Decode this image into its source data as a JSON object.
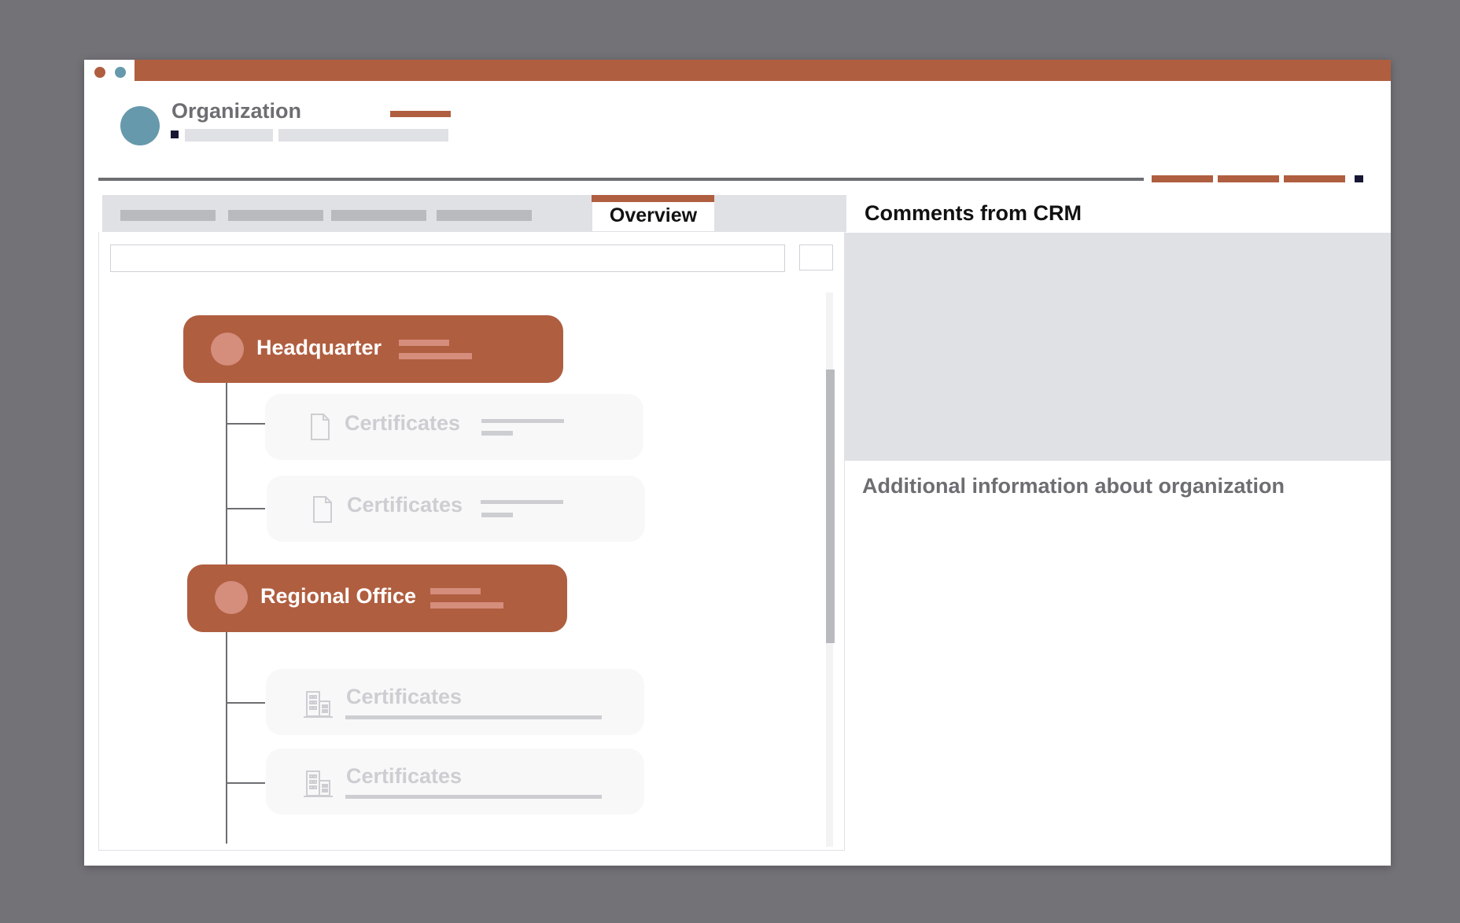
{
  "window": {
    "controls": [
      {
        "name": "close",
        "color": "#b05e40"
      },
      {
        "name": "minimize",
        "color": "#6699ab"
      }
    ]
  },
  "header": {
    "title": "Organization",
    "avatar_color": "#6699ab"
  },
  "tabs": {
    "active_label": "Overview"
  },
  "tree": {
    "nodes": [
      {
        "label": "Headquarter",
        "children": [
          {
            "label": "Certificates",
            "icon": "document-icon"
          },
          {
            "label": "Certificates",
            "icon": "document-icon"
          }
        ]
      },
      {
        "label": "Regional Office",
        "children": [
          {
            "label": "Certificates",
            "icon": "building-icon"
          },
          {
            "label": "Certificates",
            "icon": "building-icon"
          }
        ]
      }
    ]
  },
  "right_panel": {
    "comments_title": "Comments from CRM",
    "additional_info": "Additional information about organization"
  },
  "colors": {
    "accent": "#b05e40",
    "avatar": "#6699ab",
    "placeholder": "#dfe1e5",
    "muted_text": "#6d6e72",
    "navy": "#171634"
  }
}
